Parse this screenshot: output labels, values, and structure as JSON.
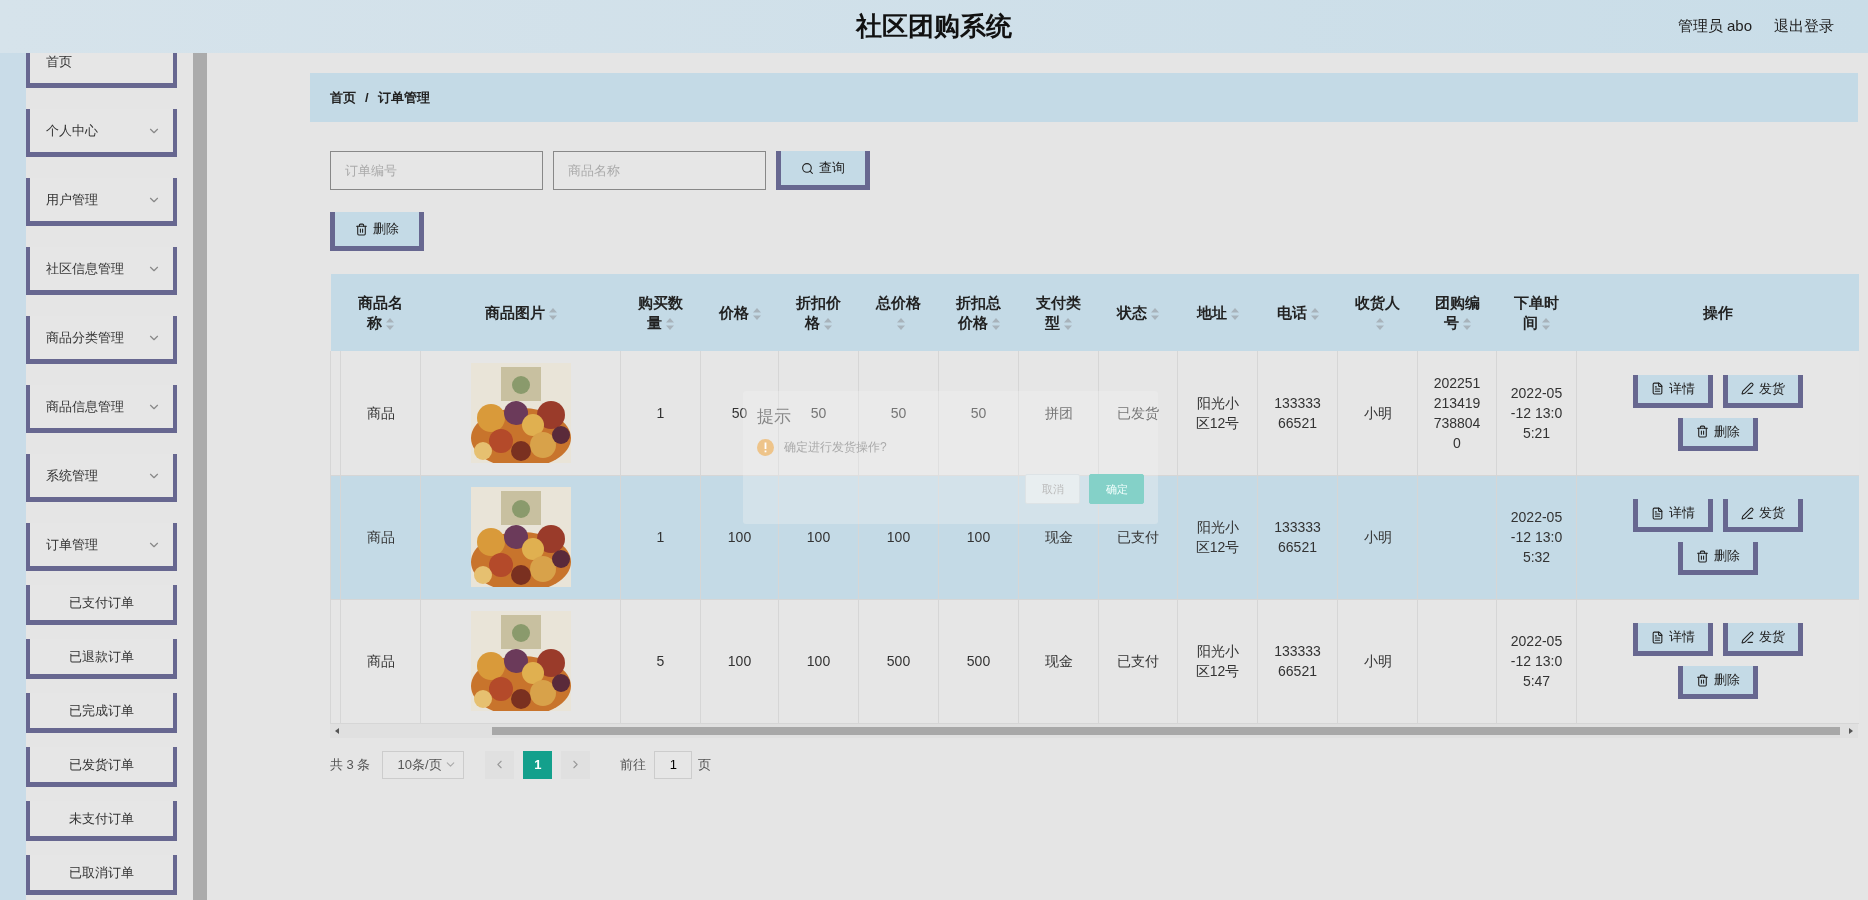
{
  "header": {
    "title": "社区团购系统",
    "user": "管理员 abo",
    "logout": "退出登录"
  },
  "sidebar": {
    "items": [
      {
        "label": "首页",
        "has_submenu": false
      },
      {
        "label": "个人中心",
        "has_submenu": true
      },
      {
        "label": "用户管理",
        "has_submenu": true
      },
      {
        "label": "社区信息管理",
        "has_submenu": true
      },
      {
        "label": "商品分类管理",
        "has_submenu": true
      },
      {
        "label": "商品信息管理",
        "has_submenu": true
      },
      {
        "label": "系统管理",
        "has_submenu": true
      },
      {
        "label": "订单管理",
        "has_submenu": true,
        "children": [
          {
            "label": "已支付订单"
          },
          {
            "label": "已退款订单"
          },
          {
            "label": "已完成订单"
          },
          {
            "label": "已发货订单"
          },
          {
            "label": "未支付订单"
          },
          {
            "label": "已取消订单"
          }
        ]
      }
    ]
  },
  "breadcrumb": {
    "items": [
      "首页",
      "订单管理"
    ],
    "separator": "/"
  },
  "search": {
    "fields": [
      {
        "placeholder": "订单编号"
      },
      {
        "placeholder": "商品名称"
      }
    ],
    "button": "查询"
  },
  "toolbar": {
    "delete_button": "删除"
  },
  "table": {
    "columns": [
      {
        "label": "商品名称",
        "sortable": true
      },
      {
        "label": "商品图片",
        "sortable": true
      },
      {
        "label": "购买数量",
        "sortable": true
      },
      {
        "label": "价格",
        "sortable": true
      },
      {
        "label": "折扣价格",
        "sortable": true
      },
      {
        "label": "总价格",
        "sortable": true
      },
      {
        "label": "折扣总价格",
        "sortable": true
      },
      {
        "label": "支付类型",
        "sortable": true
      },
      {
        "label": "状态",
        "sortable": true
      },
      {
        "label": "地址",
        "sortable": true
      },
      {
        "label": "电话",
        "sortable": true
      },
      {
        "label": "收货人",
        "sortable": true
      },
      {
        "label": "团购编号",
        "sortable": true
      },
      {
        "label": "下单时间",
        "sortable": true
      },
      {
        "label": "操作",
        "sortable": false
      }
    ],
    "rows": [
      {
        "highlighted": false,
        "product": "商品",
        "quantity": "1",
        "price": "50",
        "discount_price": "50",
        "total_price": "50",
        "discount_total": "50",
        "payment_type": "拼团",
        "status": "已发货",
        "address": "阳光小区12号",
        "phone": "13333366521",
        "receiver": "小明",
        "group_number": "2022512134197388040",
        "order_time": "2022-05-12 13:05:21",
        "actions": [
          "详情",
          "发货",
          "删除"
        ]
      },
      {
        "highlighted": true,
        "product": "商品",
        "quantity": "1",
        "price": "100",
        "discount_price": "100",
        "total_price": "100",
        "discount_total": "100",
        "payment_type": "现金",
        "status": "已支付",
        "address": "阳光小区12号",
        "phone": "13333366521",
        "receiver": "小明",
        "order_time": "2022-05-12 13:05:32",
        "actions": [
          "详情",
          "发货",
          "删除"
        ]
      },
      {
        "highlighted": false,
        "product": "商品",
        "quantity": "5",
        "price": "100",
        "discount_price": "100",
        "total_price": "500",
        "discount_total": "500",
        "payment_type": "现金",
        "status": "已支付",
        "address": "阳光小区12号",
        "phone": "13333366521",
        "receiver": "小明",
        "order_time": "2022-05-12 13:05:47",
        "actions": [
          "详情",
          "发货",
          "删除"
        ]
      }
    ]
  },
  "pagination": {
    "total": "共 3 条",
    "page_size": "10条/页",
    "pages": [
      {
        "label": "1",
        "selected": true
      }
    ],
    "goto_label": "前往",
    "goto_value": "1",
    "goto_suffix": "页"
  },
  "dialog": {
    "title": "提示",
    "message": "确定进行发货操作?",
    "buttons": [
      {
        "label": "取消",
        "kind": "secondary"
      },
      {
        "label": "确定",
        "kind": "primary"
      }
    ]
  }
}
